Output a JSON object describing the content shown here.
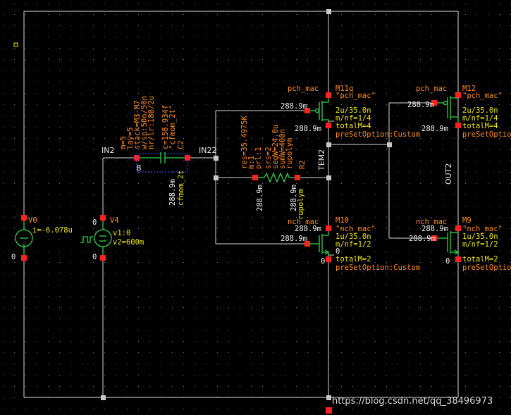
{
  "nets": {
    "in2": "IN2",
    "in22": "IN22",
    "tem2": "TEM2",
    "out2": "OUT2"
  },
  "pmos_left": {
    "cell": "pch_mac",
    "inst": "M11q",
    "model": "\"pch_mac\"",
    "size": "2u/35.0n",
    "mnf": "m/nf=1/4",
    "total": "totalM=4",
    "preset": "preSetOption:Custom",
    "op_gate": "288.9m",
    "op_bulk": "288.9m"
  },
  "pmos_right": {
    "cell": "pch_mac",
    "inst": "M12",
    "model": "\"pch_mac\"",
    "size": "2u/35.0n",
    "mnf": "m/nf=1/4",
    "total": "totalM=4",
    "preset": "preSetOption",
    "op_gate": "288.9m",
    "op_bulk": "288.9m"
  },
  "nmos_left": {
    "cell": "nch_mac",
    "inst": "M10",
    "model": "\"nch_mac\"",
    "size": "1u/35.0n",
    "mnf": "m/nf=1/2",
    "total": "totalM=2",
    "preset": "preSetOption:Custom",
    "op_top": "288.9m",
    "op_gate": "288.9m",
    "op_src": "0",
    "op_bulk": "0",
    "op_zero": "0"
  },
  "nmos_right": {
    "cell": "nch_mac",
    "inst": "M9",
    "model": "\"nch_mac\"",
    "size": "1u/35.0n",
    "mnf": "m/nf=1/2",
    "total": "totalM=2",
    "preset": "preSetOption",
    "op_top": "288.9m",
    "op_gate": "288.9m",
    "op_bulk": "0"
  },
  "resistor": {
    "inst": "R2",
    "params": [
      "res=35.4975K",
      "m:1",
      "prl:1",
      "srs=2",
      "segW=24.0u",
      "sumW=400n",
      "rupolym"
    ],
    "cell": "rupolym",
    "op_left": "288.9m",
    "op_right": "288.9m"
  },
  "capacitor": {
    "inst": "C2",
    "params": [
      "m=5",
      "lay=5",
      "stack=M3-M7",
      "w/sp:50n/50n",
      "nr/lr:180/2u",
      "c=158.934f"
    ],
    "cell": "cfmom_2t",
    "label": "\"cfmom_2t\"",
    "op": "288.9m",
    "cell2": "cfmom_2t"
  },
  "current_source": {
    "inst": "V0",
    "value": "i=-6.078u",
    "op_bottom": "0"
  },
  "pulse_source": {
    "inst": "V4",
    "v1": "v1:0",
    "v2": "v2=600m",
    "op_top": "0",
    "op_bottom": "0"
  },
  "watermark": "https://blog.csdn.net/qq_38496973",
  "colors": {
    "background": "#000000",
    "wire": "#d8d8d8",
    "device": "#2fd24a",
    "label": "#ff8c1a",
    "param": "#f2e600",
    "pin": "#ff2020"
  }
}
